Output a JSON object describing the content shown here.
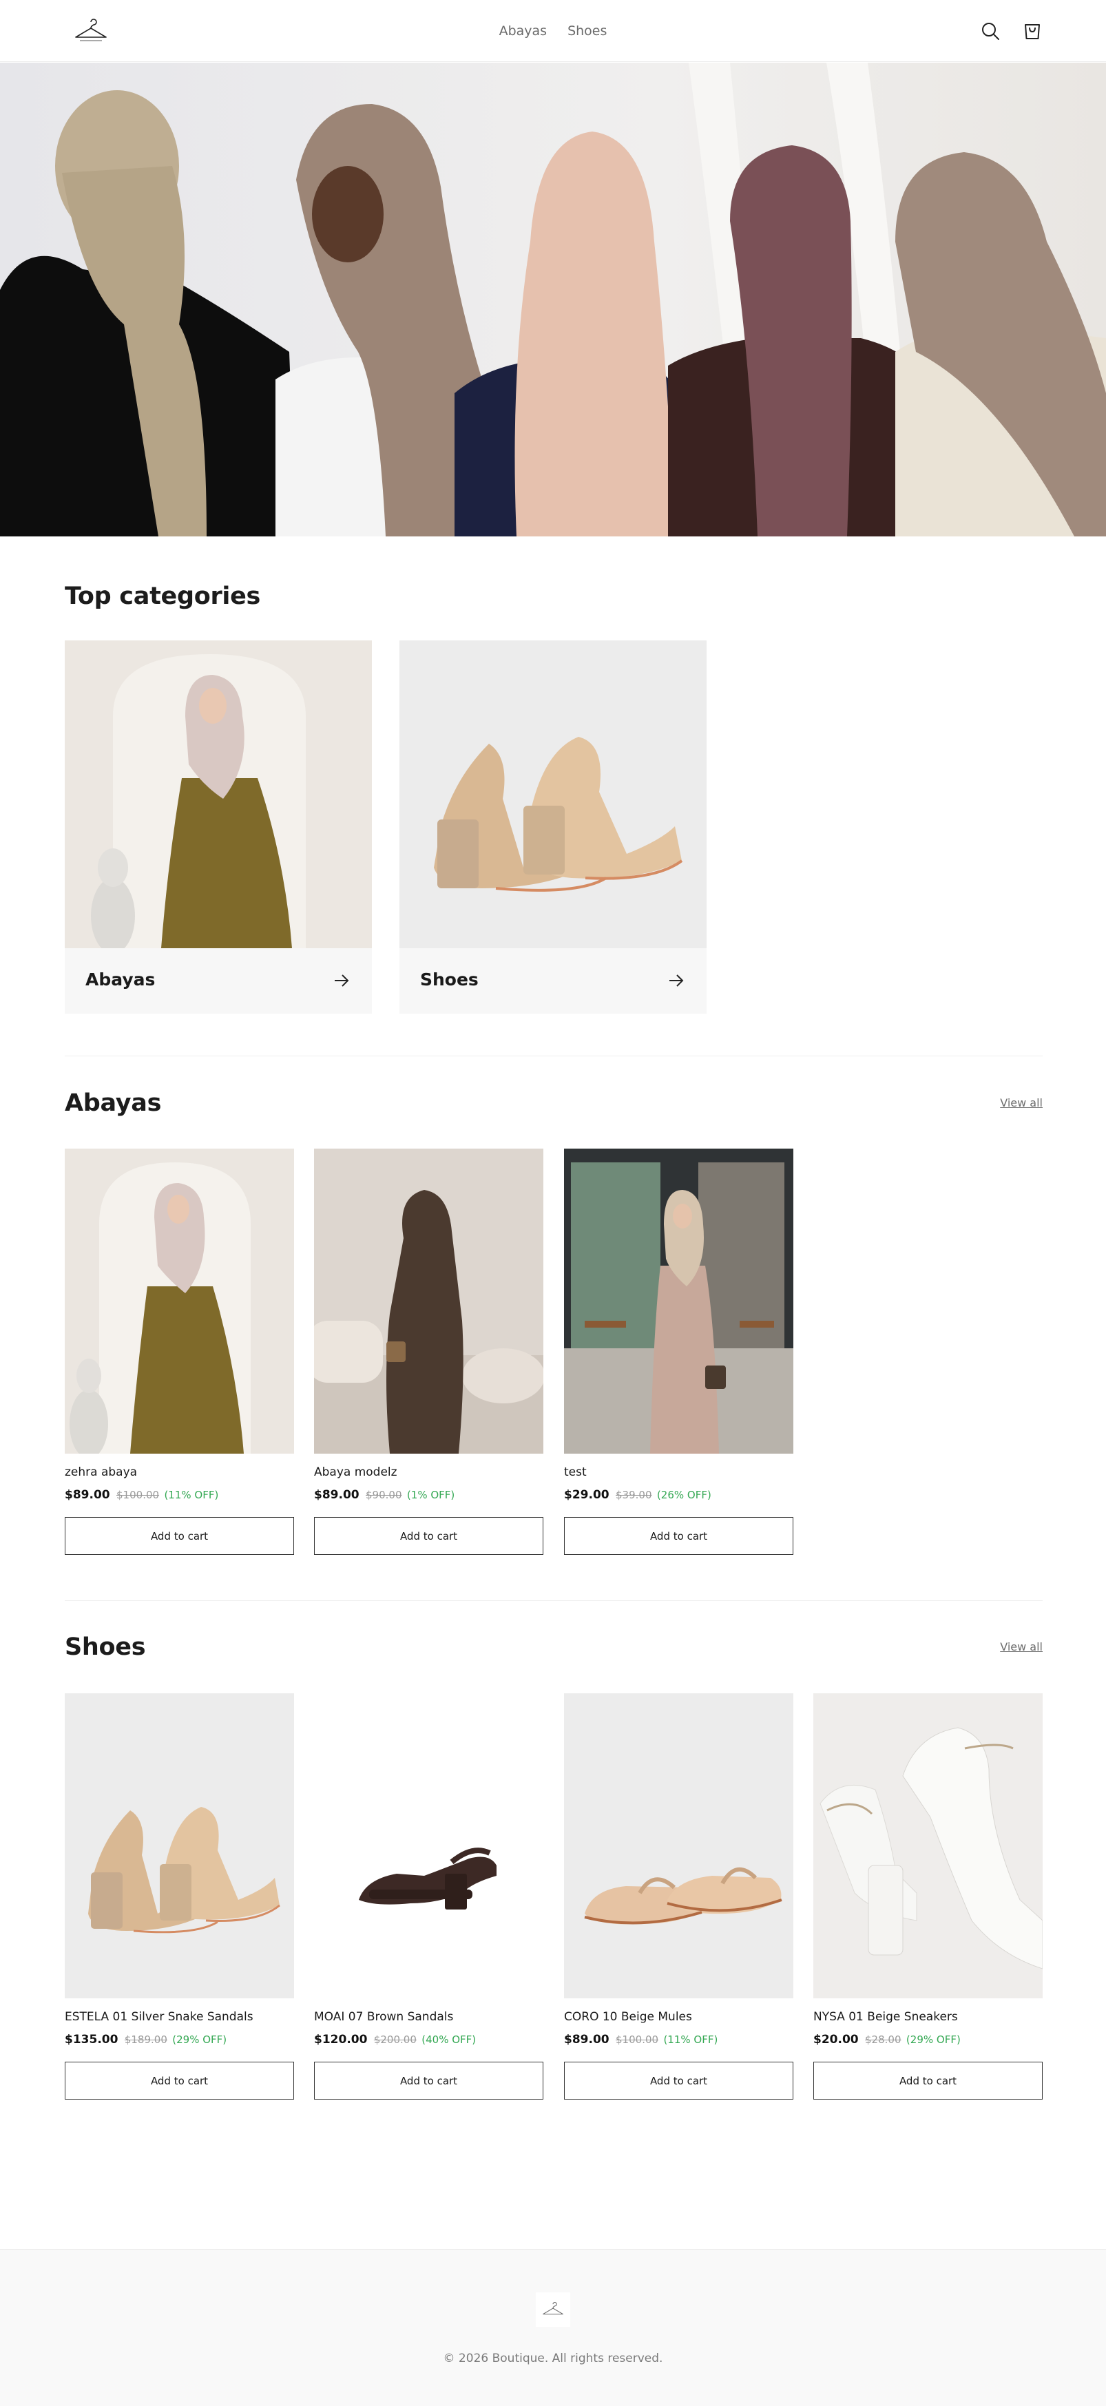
{
  "header": {
    "logo_alt": "Boutique",
    "nav": [
      "Abayas",
      "Shoes"
    ]
  },
  "categories": {
    "title": "Top categories",
    "items": [
      {
        "label": "Abayas"
      },
      {
        "label": "Shoes"
      }
    ]
  },
  "abayas": {
    "title": "Abayas",
    "view_all": "View all",
    "products": [
      {
        "name": "zehra abaya",
        "price": "$89.00",
        "old_price": "$100.00",
        "discount": "(11% OFF)",
        "button": "Add to cart"
      },
      {
        "name": "Abaya modelz",
        "price": "$89.00",
        "old_price": "$90.00",
        "discount": "(1% OFF)",
        "button": "Add to cart"
      },
      {
        "name": "test",
        "price": "$29.00",
        "old_price": "$39.00",
        "discount": "(26% OFF)",
        "button": "Add to cart"
      }
    ]
  },
  "shoes": {
    "title": "Shoes",
    "view_all": "View all",
    "products": [
      {
        "name": "ESTELA 01 Silver Snake Sandals",
        "price": "$135.00",
        "old_price": "$189.00",
        "discount": "(29% OFF)",
        "button": "Add to cart"
      },
      {
        "name": "MOAI 07 Brown Sandals",
        "price": "$120.00",
        "old_price": "$200.00",
        "discount": "(40% OFF)",
        "button": "Add to cart"
      },
      {
        "name": "CORO 10 Beige Mules",
        "price": "$89.00",
        "old_price": "$100.00",
        "discount": "(11% OFF)",
        "button": "Add to cart"
      },
      {
        "name": "NYSA 01 Beige Sneakers",
        "price": "$20.00",
        "old_price": "$28.00",
        "discount": "(29% OFF)",
        "button": "Add to cart"
      }
    ]
  },
  "footer": {
    "copyright": "© 2026 Boutique. All rights reserved."
  },
  "colors": {
    "accent_discount": "#34a853",
    "text_primary": "#1a1a1a",
    "muted": "#9a9a9a"
  },
  "icons": [
    "hanger-logo-icon",
    "search-icon",
    "shopping-bag-icon",
    "arrow-right-icon"
  ]
}
